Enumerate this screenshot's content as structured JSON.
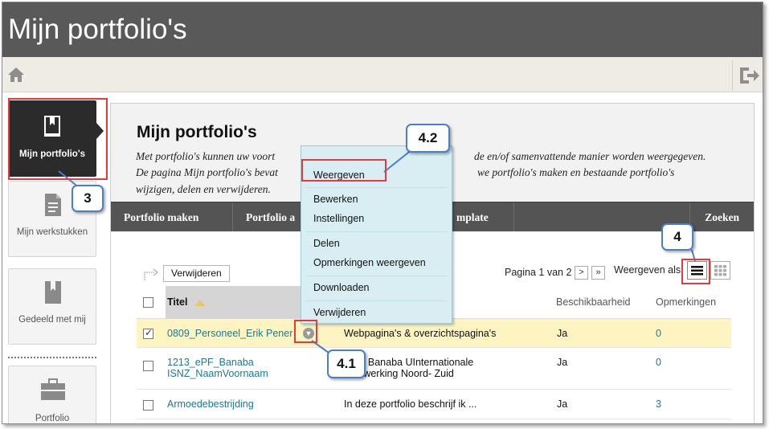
{
  "app": {
    "title": "Mijn portfolio's"
  },
  "toolbar": {
    "home_icon": "home-icon",
    "logout_icon": "logout-icon"
  },
  "nav": {
    "items": [
      {
        "label": "Mijn portfolio's",
        "icon": "bookmark-book-icon",
        "active": true
      },
      {
        "label": "Mijn werkstukken",
        "icon": "document-icon",
        "active": false
      },
      {
        "label": "Gedeeld met mij",
        "icon": "bookmark-book-icon",
        "active": false
      },
      {
        "label": "Portfolio",
        "icon": "briefcase-icon",
        "active": false
      }
    ]
  },
  "page": {
    "heading": "Mijn portfolio's",
    "description_lines": [
      "Met portfolio's kunnen uw voort",
      "de en/of samenvattende manier worden weergegeven.",
      "De pagina Mijn portfolio's bevat",
      "we portfolio's maken en bestaande portfolio's",
      "wijzigen, delen en verwijderen."
    ]
  },
  "actions": {
    "create": "Portfolio maken",
    "second": "Portfolio a",
    "template": "mplate",
    "search": "Zoeken"
  },
  "list": {
    "delete_button": "Verwijderen",
    "pager": "Pagina 1 van 2",
    "next": ">",
    "last": "»",
    "view_as": "Weergeven als",
    "columns": {
      "title": "Titel",
      "availability": "Beschikbaarheid",
      "comments": "Opmerkingen"
    },
    "rows": [
      {
        "title": "0809_Personeel_Erik Pener",
        "description": "Webpagina's & overzichtspagina's",
        "availability": "Ja",
        "comments": "0",
        "checked": true
      },
      {
        "title_line1": "1213_ePF_Banaba",
        "title_line2": "ISNZ_NaamVoornaam",
        "description_line1": "tfolio Banaba UInternationale",
        "description_line2": "menwerking Noord- Zuid",
        "availability": "Ja",
        "comments": "0",
        "checked": false
      },
      {
        "title": "Armoedebestrijding",
        "description": "In deze portfolio beschrijf ik ...",
        "availability": "Ja",
        "comments": "3",
        "checked": false
      }
    ]
  },
  "context_menu": {
    "items": [
      "Weergeven",
      "Bewerken",
      "Instellingen",
      "Delen",
      "Opmerkingen weergeven",
      "Downloaden",
      "Verwijderen"
    ]
  },
  "callouts": {
    "c3": "3",
    "c4": "4",
    "c41": "4.1",
    "c42": "4.2"
  },
  "colors": {
    "header": "#595959",
    "annotation_red": "#e23b3b",
    "callout_blue": "#4a7fc9",
    "link": "#1d7a8c",
    "menu_bg": "#d8eef3",
    "highlight_row": "#fdf4c2"
  }
}
